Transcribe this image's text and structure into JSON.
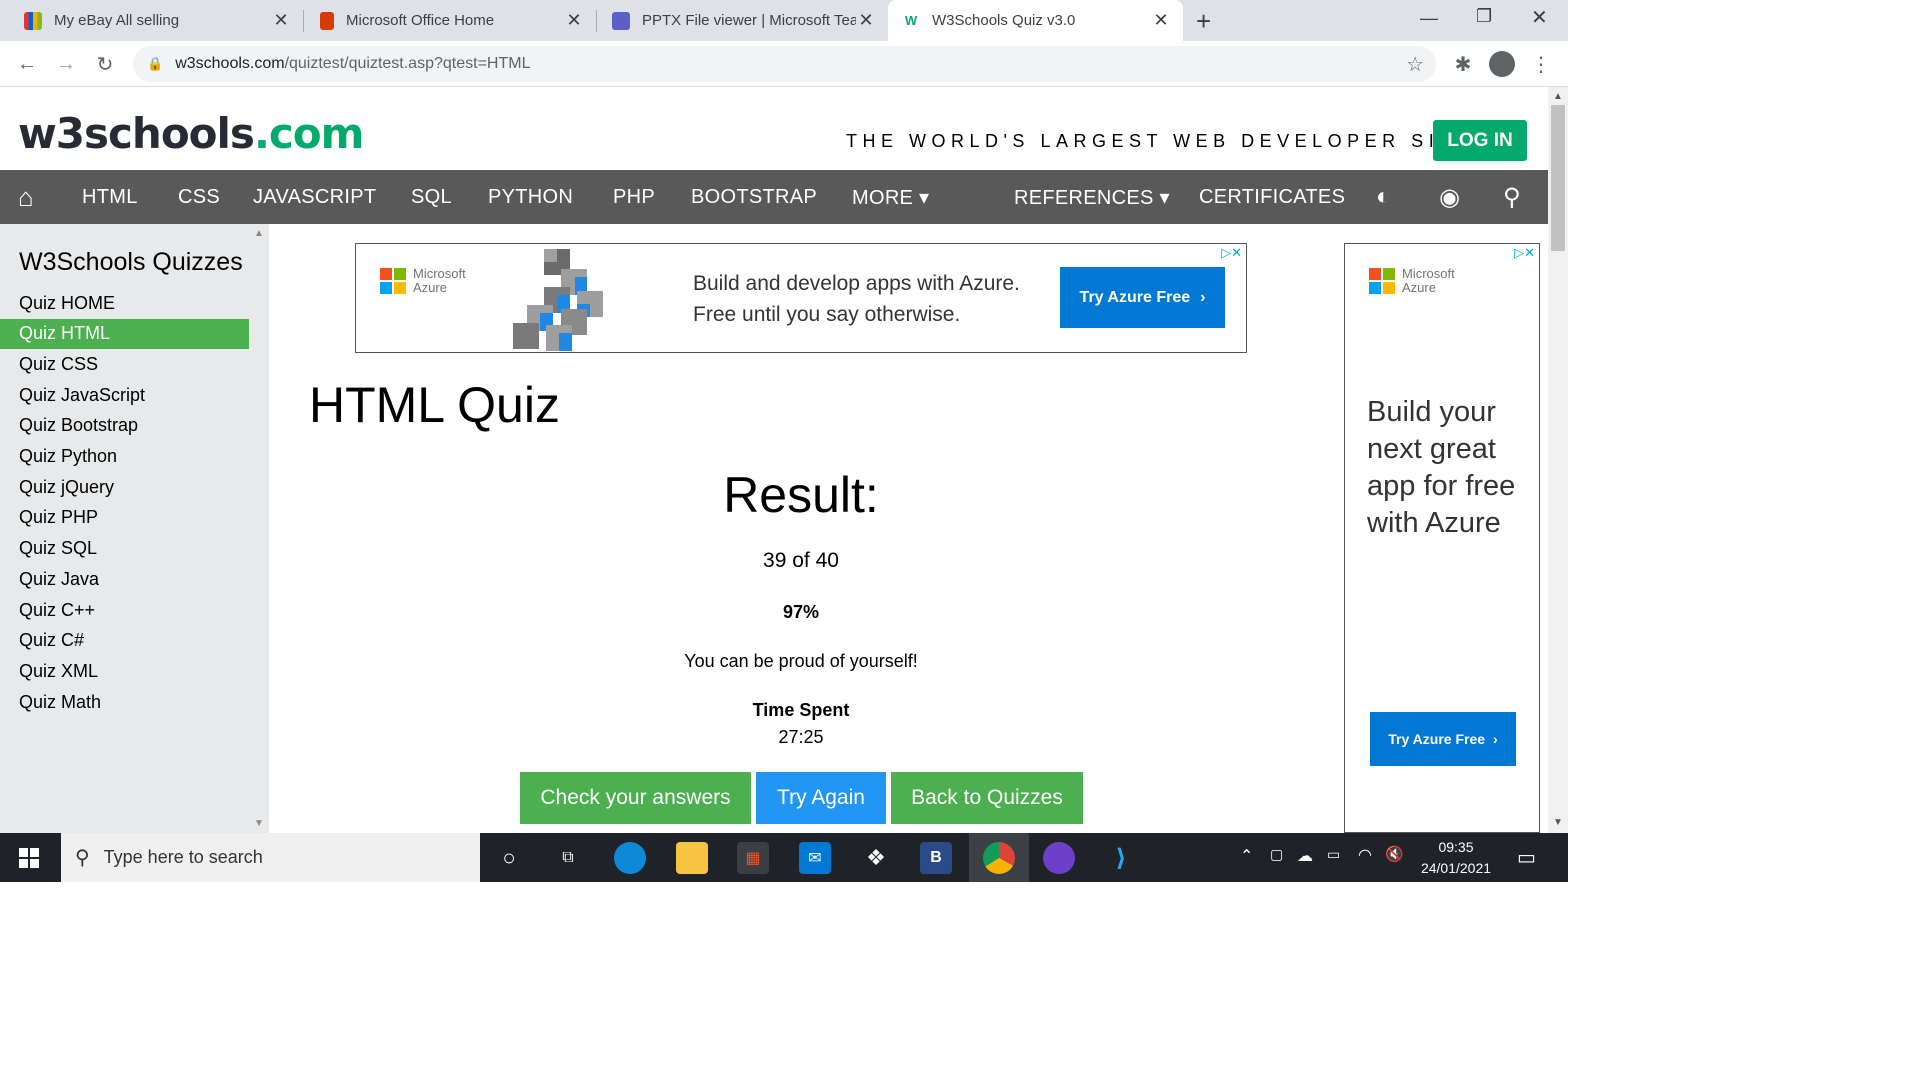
{
  "browser": {
    "tabs": [
      {
        "title": "My eBay All selling",
        "icon": "ebay-icon",
        "color": "#e53238"
      },
      {
        "title": "Microsoft Office Home",
        "icon": "office-icon",
        "color": "#d83b01"
      },
      {
        "title": "PPTX File viewer | Microsoft Team",
        "icon": "teams-icon",
        "color": "#5b5fc7"
      },
      {
        "title": "W3Schools Quiz v3.0",
        "icon": "w3schools-icon",
        "color": "#04aa6d"
      }
    ],
    "new_tab": "+",
    "url_host": "w3schools.com",
    "url_path": "/quiztest/quiztest.asp?qtest=HTML"
  },
  "header": {
    "logo_main": "w3schools",
    "logo_suffix": ".com",
    "tagline": "THE WORLD'S LARGEST WEB DEVELOPER SITE",
    "login": "LOG IN"
  },
  "nav": {
    "items": [
      "HTML",
      "CSS",
      "JAVASCRIPT",
      "SQL",
      "PYTHON",
      "PHP",
      "BOOTSTRAP",
      "MORE ▾",
      "REFERENCES ▾",
      "CERTIFICATES"
    ]
  },
  "sidebar": {
    "heading": "W3Schools Quizzes",
    "items": [
      "Quiz HOME",
      "Quiz HTML",
      "Quiz CSS",
      "Quiz JavaScript",
      "Quiz Bootstrap",
      "Quiz Python",
      "Quiz jQuery",
      "Quiz PHP",
      "Quiz SQL",
      "Quiz Java",
      "Quiz C++",
      "Quiz C#",
      "Quiz XML",
      "Quiz Math"
    ],
    "active_index": 1
  },
  "ad_top": {
    "brand_line1": "Microsoft",
    "brand_line2": "Azure",
    "line1": "Build and develop apps with Azure.",
    "line2": "Free until you say otherwise.",
    "cta": "Try Azure Free"
  },
  "main": {
    "title": "HTML Quiz",
    "result_heading": "Result:",
    "score": "39 of 40",
    "percent": "97%",
    "message": "You can be proud of yourself!",
    "time_label": "Time Spent",
    "time_value": "27:25",
    "buttons": [
      "Check your answers",
      "Try Again",
      "Back to Quizzes"
    ]
  },
  "ad_right": {
    "brand_line1": "Microsoft",
    "brand_line2": "Azure",
    "headline": "Build your next great app for free with Azure",
    "cta": "Try Azure Free"
  },
  "taskbar": {
    "search_placeholder": "Type here to search",
    "time": "09:35",
    "date": "24/01/2021"
  },
  "colors": {
    "w3_green": "#04aa6d",
    "active_sidebar": "#4caf50",
    "try_again_blue": "#2196f3",
    "azure_blue": "#0078d4",
    "nav_grey": "#595959"
  }
}
